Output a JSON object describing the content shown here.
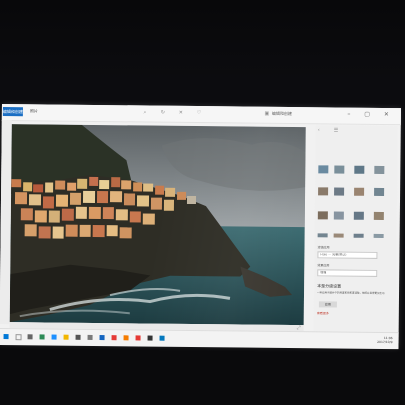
{
  "app": {
    "name_button": "编辑和创建",
    "breadcrumb": "照片"
  },
  "toolbar": {
    "icons": [
      "zoom-icon",
      "rotate-icon",
      "delete-icon",
      "heart-icon",
      "crop-icon"
    ],
    "action_label": "编辑和创建"
  },
  "panel": {
    "section1_title": "滤镜应用",
    "field1": "Halo — 光晕(默认)",
    "section2_title": "效果应用",
    "field2": "增强",
    "heading": "本是分级设置",
    "description": "一些应用于图片中的亮度和饱和度调整，使照片显得更加生动",
    "apply_label": "应用",
    "link_text": "查看更多"
  },
  "taskbar": {
    "time": "11:06",
    "date": "2017/10/9"
  },
  "colors": {
    "accent": "#1b6fc4",
    "link": "#c0392b"
  }
}
